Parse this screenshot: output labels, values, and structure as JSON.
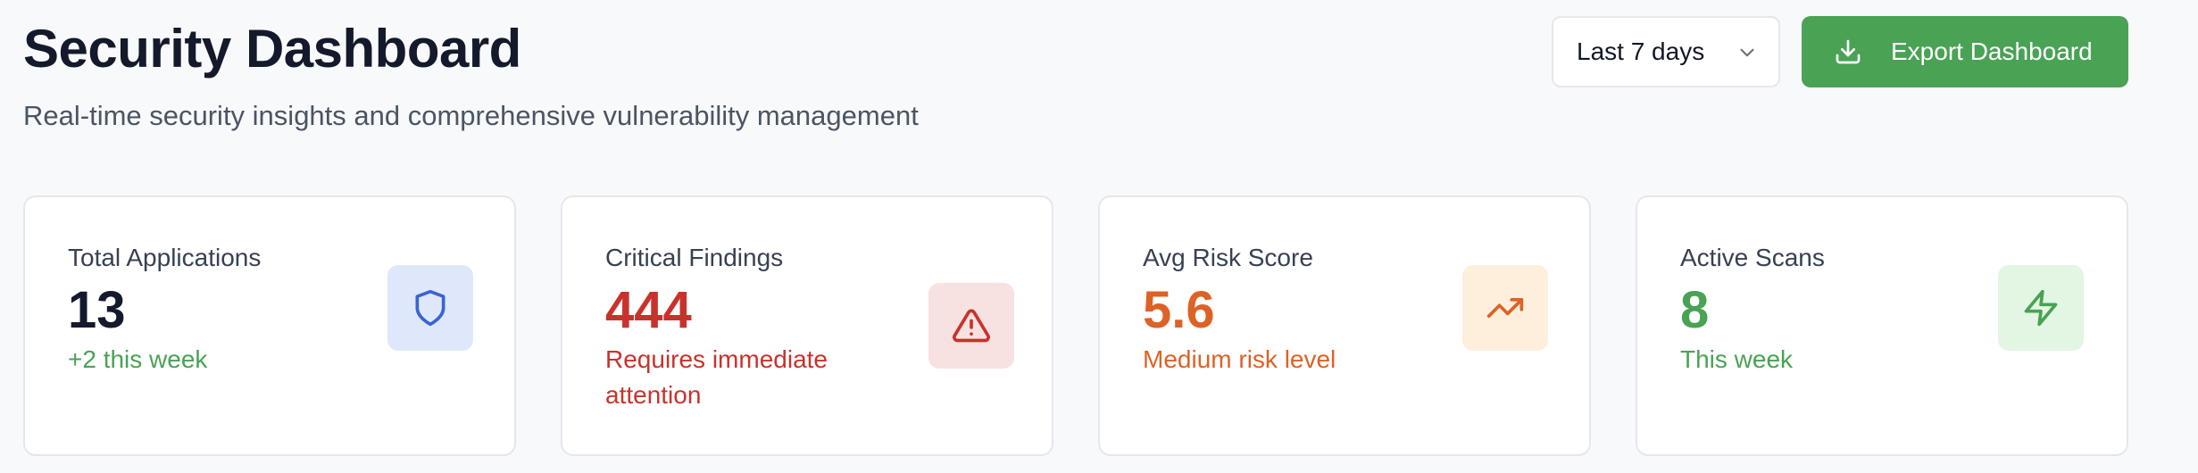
{
  "header": {
    "title": "Security Dashboard",
    "subtitle": "Real-time security insights and comprehensive vulnerability management"
  },
  "controls": {
    "range": {
      "selected": "Last 7 days",
      "icon": "chevron-down-icon"
    },
    "export": {
      "label": "Export Dashboard",
      "icon": "download-icon",
      "color": "#4aa255"
    }
  },
  "cards": [
    {
      "label": "Total Applications",
      "value": "13",
      "note": "+2 this week",
      "icon": "shield-icon",
      "value_color": "#141a2b",
      "note_color": "#4aa255",
      "badge_bg": "#dfe8fb",
      "icon_color": "#3a63d6"
    },
    {
      "label": "Critical Findings",
      "value": "444",
      "note": "Requires immediate attention",
      "icon": "alert-triangle-icon",
      "value_color": "#c9322c",
      "note_color": "#c9322c",
      "badge_bg": "#f8e1e1",
      "icon_color": "#c9322c"
    },
    {
      "label": "Avg Risk Score",
      "value": "5.6",
      "note": "Medium risk level",
      "icon": "trending-up-icon",
      "value_color": "#dd6226",
      "note_color": "#dd6226",
      "badge_bg": "#fdefdc",
      "icon_color": "#dd6226"
    },
    {
      "label": "Active Scans",
      "value": "8",
      "note": "This week",
      "icon": "lightning-icon",
      "value_color": "#4aa255",
      "note_color": "#4aa255",
      "badge_bg": "#e2f6e3",
      "icon_color": "#4aa255"
    }
  ]
}
